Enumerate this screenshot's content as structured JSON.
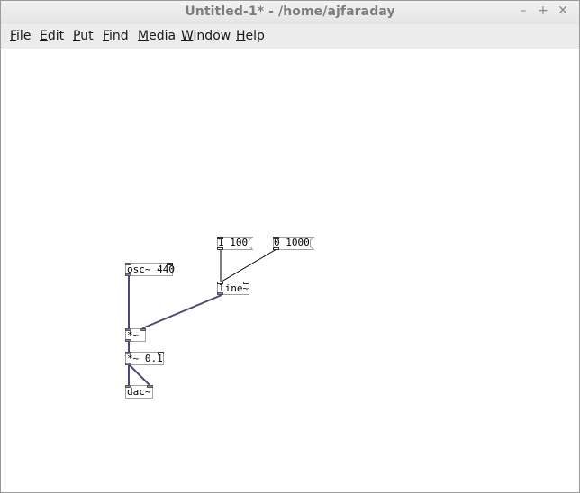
{
  "window": {
    "title": "Untitled-1* - /home/ajfaraday",
    "controls": [
      "–",
      "+",
      "✕"
    ]
  },
  "menu": {
    "items": [
      {
        "mnemonic": "F",
        "rest": "ile"
      },
      {
        "mnemonic": "E",
        "rest": "dit"
      },
      {
        "mnemonic": "P",
        "rest": "ut"
      },
      {
        "mnemonic": "F",
        "rest": "ind"
      },
      {
        "mnemonic": "M",
        "rest": "edia"
      },
      {
        "mnemonic": "W",
        "rest": "indow"
      },
      {
        "mnemonic": "H",
        "rest": "elp"
      }
    ]
  },
  "patch": {
    "objects": {
      "osc": "osc~ 440",
      "line": "line~",
      "mul": "*~",
      "mul_gain": "*~ 0.1",
      "dac": "dac~"
    },
    "messages": {
      "msg_ramp_up": "1 100",
      "msg_ramp_down": "0 1000"
    }
  },
  "colors": {
    "signal_wire": "#4a4a78",
    "control_wire": "#000000",
    "box_border": "#a0a0a0",
    "title_text": "#7d7d7d"
  }
}
